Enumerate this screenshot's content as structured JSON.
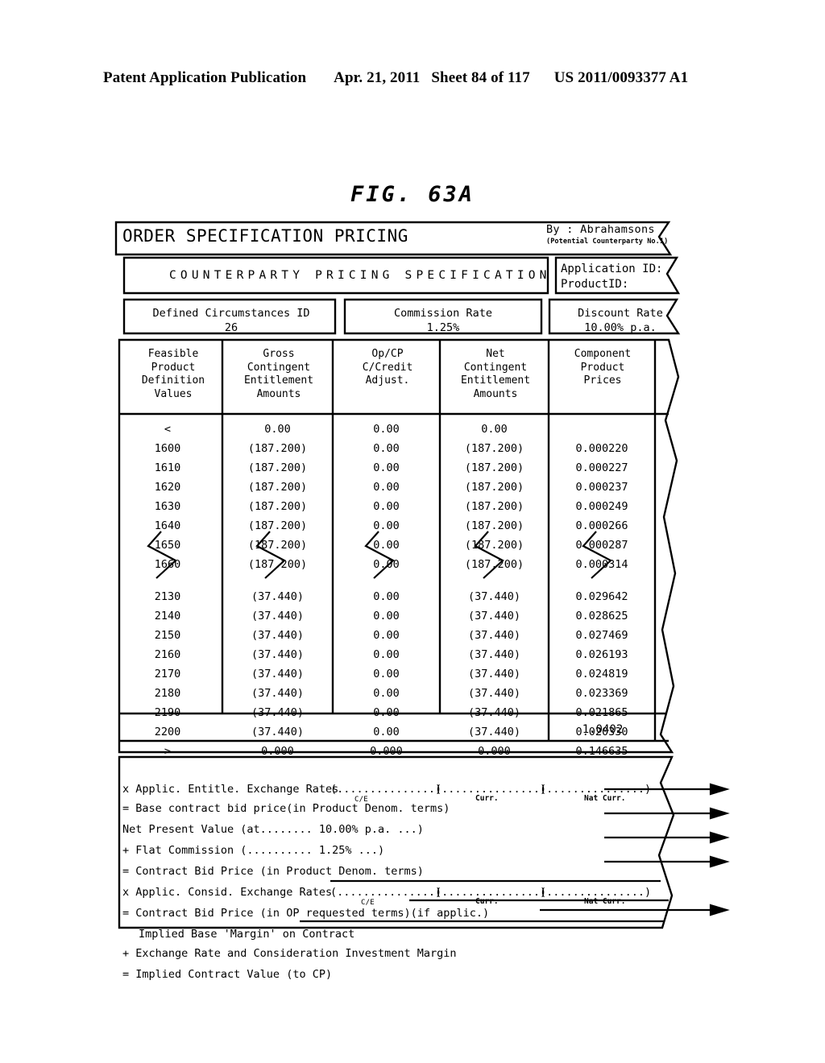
{
  "page_header": {
    "publication": "Patent Application Publication",
    "date": "Apr. 21, 2011",
    "sheet": "Sheet 84 of 117",
    "pub_number": "US 2011/0093377 A1"
  },
  "figure": {
    "label": "FIG. 63A"
  },
  "form": {
    "title": "ORDER SPECIFICATION PRICING",
    "by_label": "By : Abrahamsons",
    "by_sub": "(Potential Counterparty No.1)",
    "spec_banner": "COUNTERPARTY PRICING SPECIFICATION",
    "application_id_label": "Application ID:",
    "product_id_label": "ProductID:",
    "params": [
      {
        "label": "Defined Circumstances ID",
        "value": "26"
      },
      {
        "label": "Commission Rate",
        "value": "1.25%"
      },
      {
        "label": "Discount Rate",
        "value": "10.00% p.a."
      }
    ],
    "columns": [
      "Feasible\nProduct\nDefinition\nValues",
      "Gross\nContingent\nEntitlement\nAmounts",
      "Op/CP\nC/Credit\nAdjust.",
      "Net\nContingent\nEntitlement\nAmounts",
      "Component\nProduct\nPrices"
    ],
    "rows_block_a": [
      [
        "<",
        "0.00",
        "0.00",
        "0.00",
        ""
      ],
      [
        "1600",
        "(187.200)",
        "0.00",
        "(187.200)",
        "0.000220"
      ],
      [
        "1610",
        "(187.200)",
        "0.00",
        "(187.200)",
        "0.000227"
      ],
      [
        "1620",
        "(187.200)",
        "0.00",
        "(187.200)",
        "0.000237"
      ],
      [
        "1630",
        "(187.200)",
        "0.00",
        "(187.200)",
        "0.000249"
      ],
      [
        "1640",
        "(187.200)",
        "0.00",
        "(187.200)",
        "0.000266"
      ],
      [
        "1650",
        "(187.200)",
        "0.00",
        "(187.200)",
        "0.000287"
      ],
      [
        "1660",
        "(187.200)",
        "0.00",
        "(187.200)",
        "0.000314"
      ]
    ],
    "rows_block_b": [
      [
        "2130",
        "(37.440)",
        "0.00",
        "(37.440)",
        "0.029642"
      ],
      [
        "2140",
        "(37.440)",
        "0.00",
        "(37.440)",
        "0.028625"
      ],
      [
        "2150",
        "(37.440)",
        "0.00",
        "(37.440)",
        "0.027469"
      ],
      [
        "2160",
        "(37.440)",
        "0.00",
        "(37.440)",
        "0.026193"
      ],
      [
        "2170",
        "(37.440)",
        "0.00",
        "(37.440)",
        "0.024819"
      ],
      [
        "2180",
        "(37.440)",
        "0.00",
        "(37.440)",
        "0.023369"
      ],
      [
        "2190",
        "(37.440)",
        "0.00",
        "(37.440)",
        "0.021865"
      ],
      [
        "2200",
        "(37.440)",
        "0.00",
        "(37.440)",
        "0.020330"
      ],
      [
        ">",
        "0.000",
        "0.000",
        "0.000",
        "0.146635"
      ]
    ],
    "total_value": "1.0402",
    "footer_lines": [
      "x Applic. Entitle. Exchange Rates",
      "= Base contract bid price(in Product Denom. terms)",
      "Net Present Value (at........          10.00% p.a.  ...)",
      "+ Flat Commission (..........             1.25%         ...)",
      "= Contract Bid Price (in Product Denom. terms)",
      "x Applic. Consid. Exchange Rates",
      "= Contract Bid Price (in OP requested terms)(if applic.)",
      "Implied Base 'Margin' on Contract",
      "+ Exchange Rate and Consideration Investment Margin",
      "= Implied Contract Value (to CP)"
    ],
    "dotted_group": "(...............)",
    "superscript_ce": "C/E",
    "curr_label": "Curr.",
    "nat_curr_label": "Nat Curr."
  },
  "colors": {
    "ink": "#000000",
    "paper": "#ffffff"
  }
}
